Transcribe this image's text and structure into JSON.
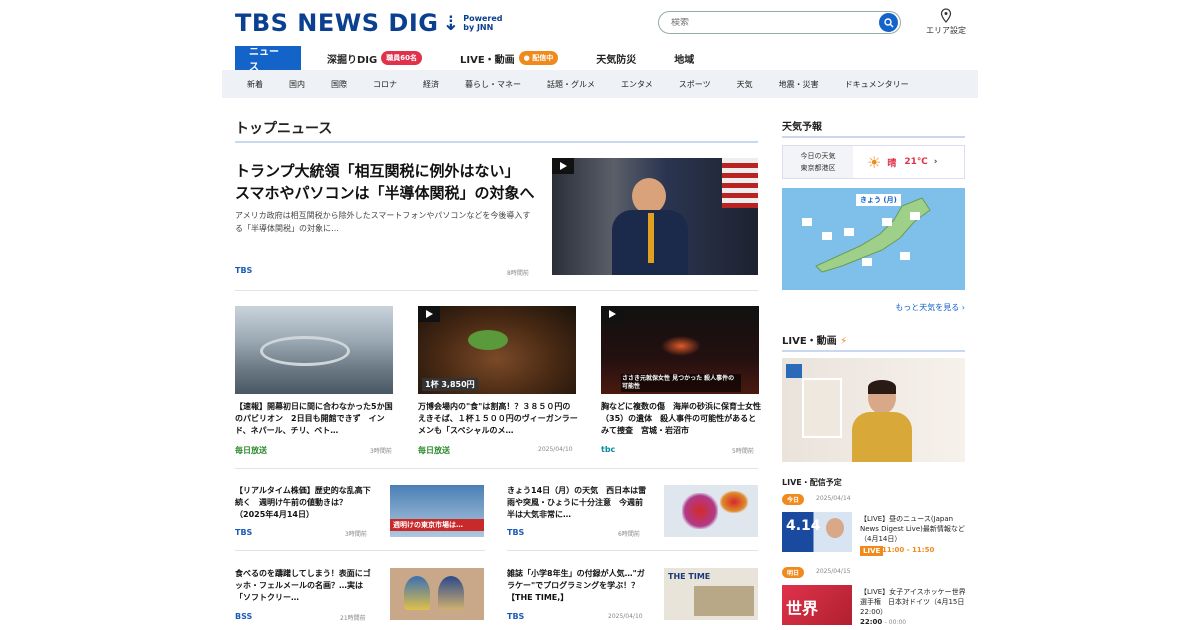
{
  "header": {
    "logo": "TBS NEWS DIG",
    "powered": "Powered",
    "by": "by JNN",
    "search_placeholder": "検索",
    "area_label": "エリア設定"
  },
  "nav": {
    "items": [
      {
        "label": "ニュース"
      },
      {
        "label": "深掘りDIG",
        "badge": "職員60名"
      },
      {
        "label": "LIVE・動画",
        "badge": "配信中"
      },
      {
        "label": "天気防災"
      },
      {
        "label": "地域"
      }
    ]
  },
  "subnav": [
    "新着",
    "国内",
    "国際",
    "コロナ",
    "経済",
    "暮らし・マネー",
    "話題・グルメ",
    "エンタメ",
    "スポーツ",
    "天気",
    "地震・災害",
    "ドキュメンタリー"
  ],
  "top": {
    "section_title": "トップニュース",
    "headline_line1": "トランプ大統領「相互関税に例外はない」",
    "headline_line2": "スマホやパソコンは「半導体関税」の対象へ",
    "lead": "アメリカ政府は相互関税から除外したスマートフォンやパソコンなどを今後導入する「半導体関税」の対象に…",
    "source": "TBS",
    "time": "8時間前"
  },
  "cards": [
    {
      "caption": "【速報】開幕初日に間に合わなかった5か国のパビリオン　2日目も開館できず　インド、ネパール、チリ、ベト…",
      "source": "毎日放送",
      "time": "3時間前",
      "img_label": ""
    },
    {
      "caption": "万博会場内の\"食\"は割高！？３８５０円のえきそば、１杯１５００円のヴィーガンラーメンも「スペシャルのメ…",
      "source": "毎日放送",
      "time": "2025/04/10",
      "img_label": "1杯 3,850円"
    },
    {
      "caption": "胸などに複数の傷　海岸の砂浜に保育士女性（35）の遺体　殺人事件の可能性があるとみて捜査　宮城・岩沼市",
      "source": "tbc",
      "time": "5時間前",
      "img_label": "ささき元就保女性 見つかった 殺人事件の可能性"
    }
  ],
  "small": [
    {
      "caption": "【リアルタイム株価】歴史的な乱高下続く　週明け午前の値動きは？（2025年4月14日）",
      "source": "TBS",
      "time": "3時間前",
      "img_label": "週明けの東京市場は…"
    },
    {
      "caption": "きょう14日（月）の天気　西日本は雷雨や突風・ひょうに十分注意　今週前半は大気非常に…",
      "source": "TBS",
      "time": "6時間前"
    },
    {
      "caption": "食べるのを躊躇してしまう！表面にゴッホ・フェルメールの名画？…実は「ソフトクリー…",
      "source": "BSS",
      "time": "21時間前"
    },
    {
      "caption": "雑誌「小学8年生」の付録が人気…\"ガラケー\"でプログラミングを学ぶ！？【THE TIME,】",
      "source": "TBS",
      "time": "2025/04/10",
      "img_label": "THE TIME"
    }
  ],
  "weather": {
    "title": "天気予報",
    "today_label": "今日の天気",
    "place": "東京都港区",
    "status": "晴",
    "temp": "21℃",
    "map_label": "きょう (月)",
    "more": "もっと天気を見る ›"
  },
  "live": {
    "title": "LIVE・動画",
    "schedule_title": "LIVE・配信予定",
    "items": [
      {
        "day": "今日",
        "date": "2025/04/14",
        "title": "【LIVE】昼のニュース(Japan News Digest Live)最新情報など（4月14日）",
        "live": "LIVE",
        "time": "11:00 - 11:50",
        "thumb": "4.14"
      },
      {
        "day": "明日",
        "date": "2025/04/15",
        "title": "【LIVE】女子アイスホッケー世界選手権　日本対ドイツ（4月15日 22:00）",
        "live": "",
        "time": "22:00",
        "time_end": "- 00:00",
        "thumb": "世界"
      }
    ]
  },
  "colors": {
    "brand": "#0b3f8f",
    "accent": "#1363c9",
    "badge_red": "#e0324b",
    "badge_orange": "#f08a1d"
  }
}
